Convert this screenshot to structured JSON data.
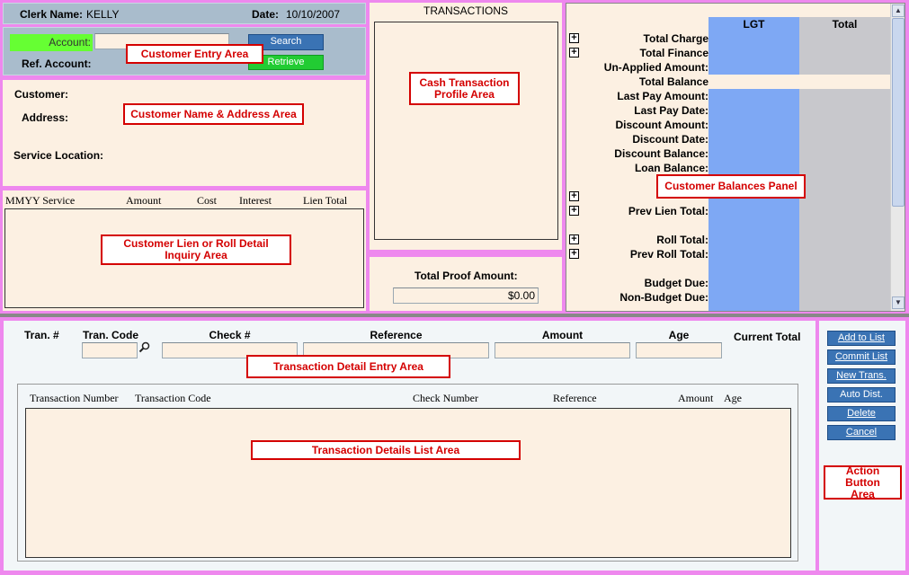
{
  "header": {
    "clerk_label": "Clerk Name:",
    "clerk_value": "KELLY",
    "date_label": "Date:",
    "date_value": "10/10/2007"
  },
  "customer_entry": {
    "account_label": "Account:",
    "ref_account_label": "Ref. Account:",
    "search_button": "Search",
    "retrieve_button": "Retrieve",
    "annotation": "Customer Entry Area"
  },
  "customer_info": {
    "customer_label": "Customer:",
    "address_label": "Address:",
    "service_location_label": "Service Location:",
    "annotation": "Customer Name & Address Area"
  },
  "lien_detail": {
    "columns": [
      "MMYY Service",
      "Amount",
      "Cost",
      "Interest",
      "Lien Total"
    ],
    "annotation_line1": "Customer Lien or Roll Detail",
    "annotation_line2": "Inquiry Area"
  },
  "transactions": {
    "title": "TRANSACTIONS",
    "annotation_line1": "Cash Transaction",
    "annotation_line2": "Profile Area"
  },
  "proof": {
    "label": "Total Proof Amount:",
    "value": "$0.00"
  },
  "balances": {
    "col_lgt": "LGT",
    "col_total": "Total",
    "rows": [
      "Total Charge",
      "Total Finance",
      "Un-Applied Amount:",
      "Total Balance",
      "Last Pay Amount:",
      "Last Pay Date:",
      "Discount Amount:",
      "Discount Date:",
      "Discount Balance:",
      "Loan Balance:",
      "Prev Lien Total:",
      "Roll Total:",
      "Prev Roll Total:",
      "Budget Due:",
      "Non-Budget Due:"
    ],
    "annotation": "Customer Balances Panel",
    "colors": {
      "lgt": "#7ea8f4",
      "total": "#c8c8cc",
      "highlight": "#fcf0e2"
    }
  },
  "entry": {
    "tran_no": "Tran. #",
    "tran_code": "Tran. Code",
    "check_no": "Check #",
    "reference": "Reference",
    "amount": "Amount",
    "age": "Age",
    "current_total": "Current Total",
    "annotation": "Transaction Detail Entry Area"
  },
  "details_list": {
    "columns": [
      "Transaction Number",
      "Transaction Code",
      "Check Number",
      "Reference",
      "Amount",
      "Age"
    ],
    "annotation": "Transaction Details List Area"
  },
  "actions": {
    "buttons": [
      "Add to List",
      "Commit List",
      "New Trans.",
      "Auto Dist.",
      "Delete",
      "Cancel"
    ],
    "annotation_line1": "Action Button",
    "annotation_line2": "Area"
  },
  "icons": {
    "lookup": "magnifier-icon",
    "expand": "plus-box-icon",
    "scroll_up": "triangle-up-icon",
    "scroll_down": "triangle-down-icon"
  }
}
